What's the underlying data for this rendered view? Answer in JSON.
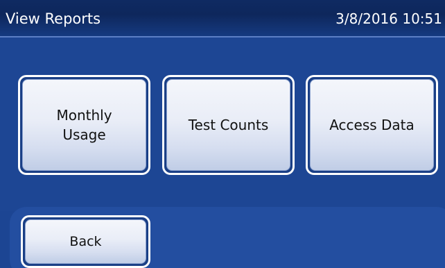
{
  "header": {
    "title": "View Reports",
    "datetime": "3/8/2016 10:51"
  },
  "buttons": {
    "monthly_usage": "Monthly\nUsage",
    "test_counts": "Test Counts",
    "access_data": "Access Data",
    "back": "Back"
  },
  "colors": {
    "background": "#1c4593",
    "title_bar": "#0f2a62",
    "button_face": "#e9edf7",
    "button_border": "#ffffff"
  }
}
